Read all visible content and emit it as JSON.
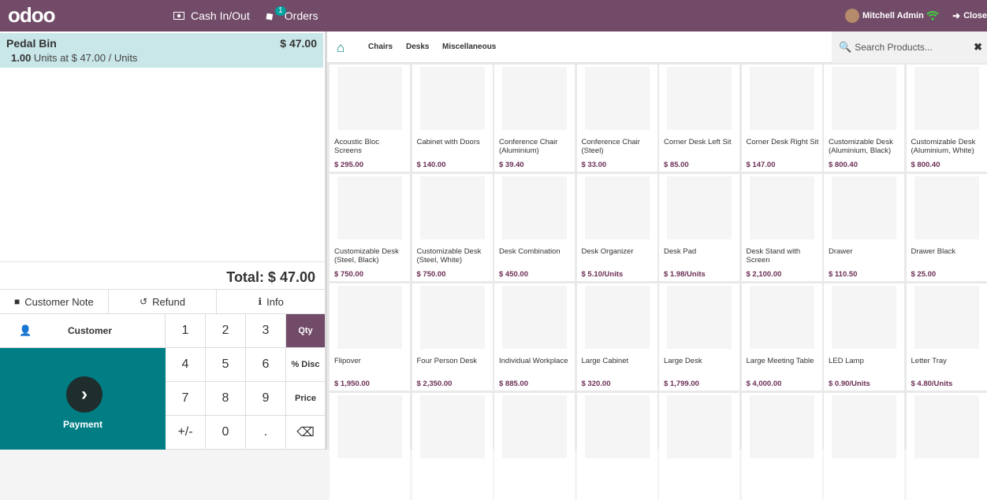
{
  "topbar": {
    "logo": "odoo",
    "cash_label": "Cash In/Out",
    "orders_label": "Orders",
    "orders_badge": "1",
    "user_name": "Mitchell Admin",
    "close_label": "Close"
  },
  "order": {
    "line_name": "Pedal Bin",
    "line_price": "$ 47.00",
    "line_qty": "1.00",
    "line_unit": " Units at $ 47.00 / Units",
    "total": "Total: $ 47.00"
  },
  "controls": {
    "note": "Customer Note",
    "refund": "Refund",
    "info": "Info"
  },
  "keypad": {
    "customer": "Customer",
    "payment": "Payment",
    "keys": [
      "1",
      "2",
      "3",
      "4",
      "5",
      "6",
      "7",
      "8",
      "9",
      "+/-",
      "0",
      "."
    ],
    "qty": "Qty",
    "disc": "% Disc",
    "price": "Price",
    "backspace": "⌫"
  },
  "categories": [
    "Chairs",
    "Desks",
    "Miscellaneous"
  ],
  "search": {
    "placeholder": "Search Products..."
  },
  "products": [
    {
      "name": "Acoustic Bloc Screens",
      "price": "$ 295.00"
    },
    {
      "name": "Cabinet with Doors",
      "price": "$ 140.00"
    },
    {
      "name": "Conference Chair (Aluminium)",
      "price": "$ 39.40"
    },
    {
      "name": "Conference Chair (Steel)",
      "price": "$ 33.00"
    },
    {
      "name": "Corner Desk Left Sit",
      "price": "$ 85.00"
    },
    {
      "name": "Corner Desk Right Sit",
      "price": "$ 147.00"
    },
    {
      "name": "Customizable Desk (Aluminium, Black)",
      "price": "$ 800.40"
    },
    {
      "name": "Customizable Desk (Aluminium, White)",
      "price": "$ 800.40"
    },
    {
      "name": "Customizable Desk (Steel, Black)",
      "price": "$ 750.00"
    },
    {
      "name": "Customizable Desk (Steel, White)",
      "price": "$ 750.00"
    },
    {
      "name": "Desk Combination",
      "price": "$ 450.00"
    },
    {
      "name": "Desk Organizer",
      "price": "$ 5.10/Units"
    },
    {
      "name": "Desk Pad",
      "price": "$ 1.98/Units"
    },
    {
      "name": "Desk Stand with Screen",
      "price": "$ 2,100.00"
    },
    {
      "name": "Drawer",
      "price": "$ 110.50"
    },
    {
      "name": "Drawer Black",
      "price": "$ 25.00"
    },
    {
      "name": "Flipover",
      "price": "$ 1,950.00"
    },
    {
      "name": "Four Person Desk",
      "price": "$ 2,350.00"
    },
    {
      "name": "Individual Workplace",
      "price": "$ 885.00"
    },
    {
      "name": "Large Cabinet",
      "price": "$ 320.00"
    },
    {
      "name": "Large Desk",
      "price": "$ 1,799.00"
    },
    {
      "name": "Large Meeting Table",
      "price": "$ 4,000.00"
    },
    {
      "name": "LED Lamp",
      "price": "$ 0.90/Units"
    },
    {
      "name": "Letter Tray",
      "price": "$ 4.80/Units"
    },
    {
      "name": "",
      "price": ""
    },
    {
      "name": "",
      "price": ""
    },
    {
      "name": "",
      "price": ""
    },
    {
      "name": "",
      "price": ""
    },
    {
      "name": "",
      "price": ""
    },
    {
      "name": "",
      "price": ""
    },
    {
      "name": "",
      "price": ""
    },
    {
      "name": "",
      "price": ""
    }
  ]
}
